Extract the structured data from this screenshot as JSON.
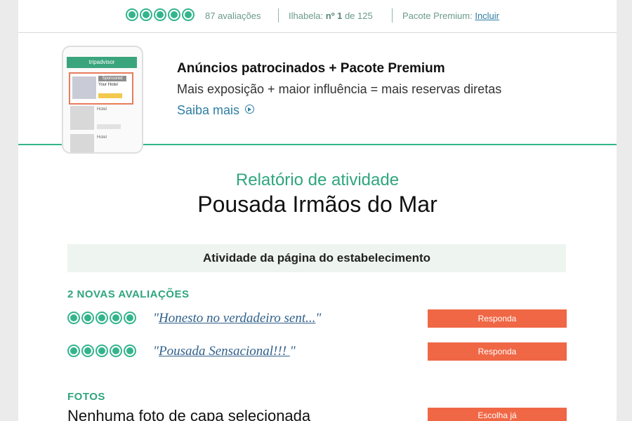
{
  "topbar": {
    "rating_bubbles": 5,
    "reviews_count": "87 avaliações",
    "rank_prefix": "Ilhabela:",
    "rank_value": "nº 1",
    "rank_suffix": "de 125",
    "premium_label": "Pacote Premium:",
    "premium_link": "Incluir"
  },
  "promo": {
    "phone_brand": "tripadvisor",
    "phone_sponsored": "Sponsored",
    "phone_hotel": "Your Hotel",
    "phone_list_label": "Hotel",
    "headline": "Anúncios patrocinados + Pacote Premium",
    "subline": "Mais exposição + maior influência = mais reservas diretas",
    "more_link": "Saiba mais"
  },
  "report": {
    "label": "Relatório de atividade",
    "property_name": "Pousada Irmãos do Mar",
    "section_title": "Atividade da página do estabelecimento"
  },
  "reviews": {
    "heading": "2 NOVAS AVALIAÇÕES",
    "items": [
      {
        "rating": 5,
        "title": "Honesto no verdadeiro sent...",
        "action": "Responda"
      },
      {
        "rating": 5,
        "title": "Pousada Sensacional!!! ",
        "action": "Responda"
      }
    ]
  },
  "photos": {
    "heading": "FOTOS",
    "status": "Nenhuma foto de capa selecionada",
    "action": "Escolha já"
  },
  "colors": {
    "brand_green": "#34b48c",
    "link_blue": "#2f7ea4",
    "cta_orange": "#f06745",
    "section_bg": "#eef4f0"
  }
}
